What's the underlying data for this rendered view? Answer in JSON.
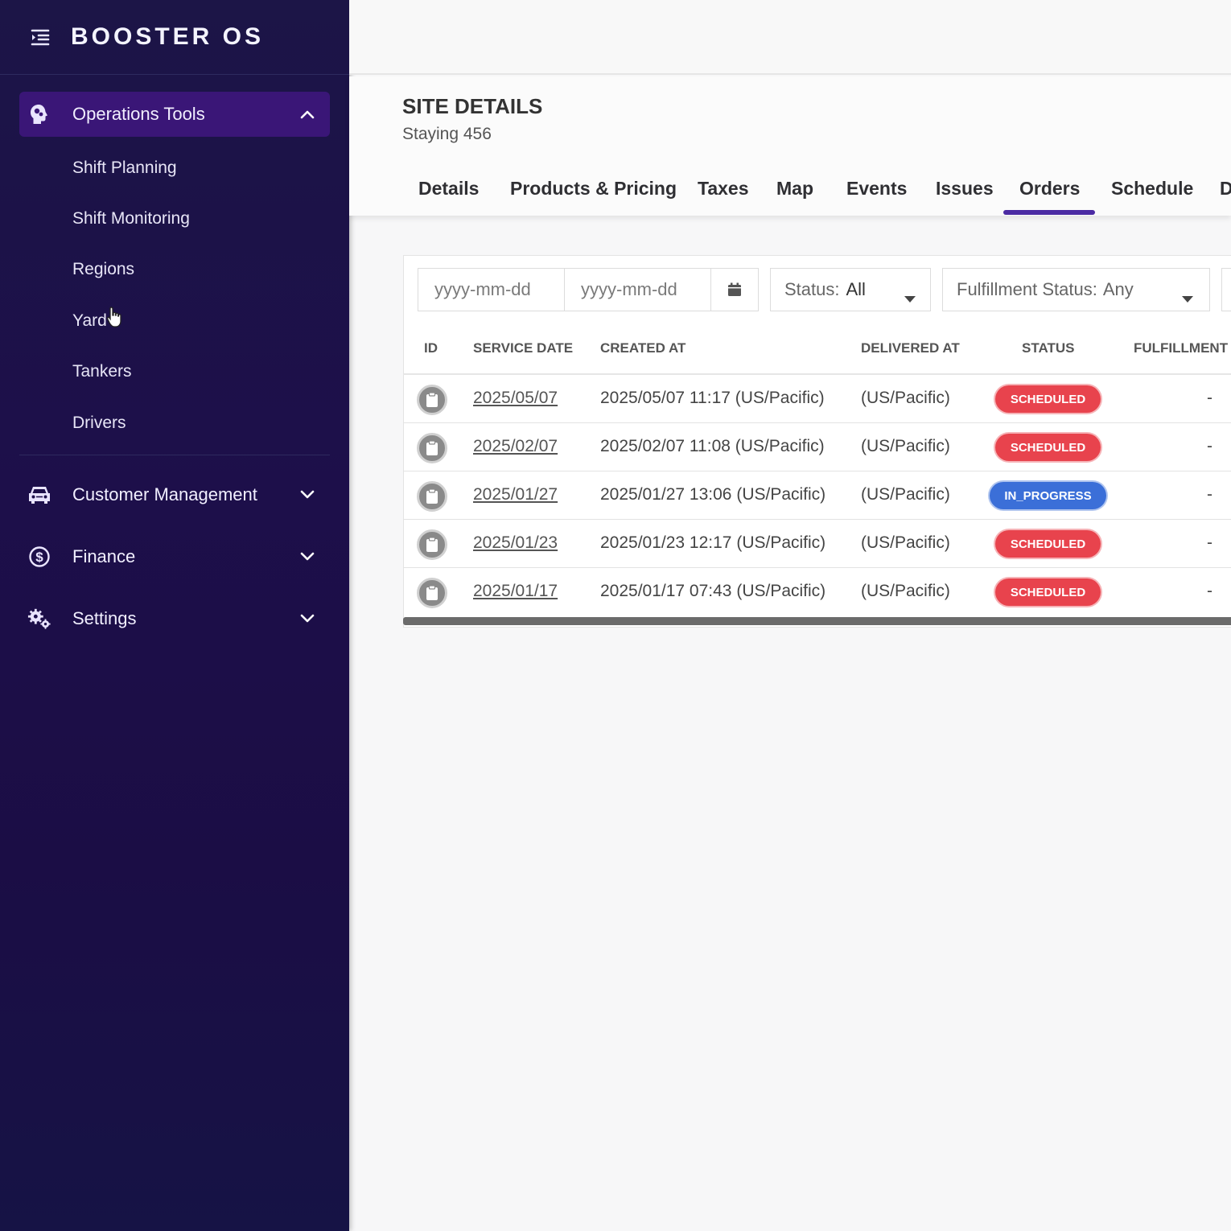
{
  "app": {
    "title": "BOOSTER OS"
  },
  "sidebar": {
    "groups": [
      {
        "label": "Operations Tools",
        "icon": "head-gears-icon",
        "expanded": true
      },
      {
        "label": "Customer Management",
        "icon": "car-icon",
        "expanded": false
      },
      {
        "label": "Finance",
        "icon": "dollar-circle-icon",
        "expanded": false
      },
      {
        "label": "Settings",
        "icon": "gears-icon",
        "expanded": false
      }
    ],
    "items": [
      {
        "label": "Shift Planning"
      },
      {
        "label": "Shift Monitoring"
      },
      {
        "label": "Regions"
      },
      {
        "label": "Yard"
      },
      {
        "label": "Tankers"
      },
      {
        "label": "Drivers"
      }
    ]
  },
  "page": {
    "title": "SITE DETAILS",
    "subtitle": "Staying 456"
  },
  "tabs": [
    {
      "label": "Details"
    },
    {
      "label": "Products & Pricing"
    },
    {
      "label": "Taxes"
    },
    {
      "label": "Map"
    },
    {
      "label": "Events"
    },
    {
      "label": "Issues"
    },
    {
      "label": "Orders",
      "active": true
    },
    {
      "label": "Schedule"
    },
    {
      "label": "D"
    }
  ],
  "filters": {
    "start_date_placeholder": "yyyy-mm-dd",
    "end_date_placeholder": "yyyy-mm-dd",
    "status_label": "Status:",
    "status_value": "All",
    "fulfillment_label": "Fulfillment Status:",
    "fulfillment_value": "Any"
  },
  "table": {
    "columns": [
      "ID",
      "SERVICE DATE",
      "CREATED AT",
      "DELIVERED AT",
      "STATUS",
      "FULFILLMENT"
    ],
    "rows": [
      {
        "service_date": "2025/05/07",
        "created_at": "2025/05/07 11:17 (US/Pacific)",
        "delivered_at": "(US/Pacific)",
        "status": "SCHEDULED",
        "fulfillment": "-"
      },
      {
        "service_date": "2025/02/07",
        "created_at": "2025/02/07 11:08 (US/Pacific)",
        "delivered_at": "(US/Pacific)",
        "status": "SCHEDULED",
        "fulfillment": "-"
      },
      {
        "service_date": "2025/01/27",
        "created_at": "2025/01/27 13:06 (US/Pacific)",
        "delivered_at": "(US/Pacific)",
        "status": "IN_PROGRESS",
        "fulfillment": "-"
      },
      {
        "service_date": "2025/01/23",
        "created_at": "2025/01/23 12:17 (US/Pacific)",
        "delivered_at": "(US/Pacific)",
        "status": "SCHEDULED",
        "fulfillment": "-"
      },
      {
        "service_date": "2025/01/17",
        "created_at": "2025/01/17 07:43 (US/Pacific)",
        "delivered_at": "(US/Pacific)",
        "status": "SCHEDULED",
        "fulfillment": "-"
      }
    ]
  },
  "colors": {
    "scheduled": "#e8434d",
    "in_progress": "#3b6fd8",
    "active_tab": "#4b2ba3",
    "sidebar_active": "#3a1677"
  }
}
